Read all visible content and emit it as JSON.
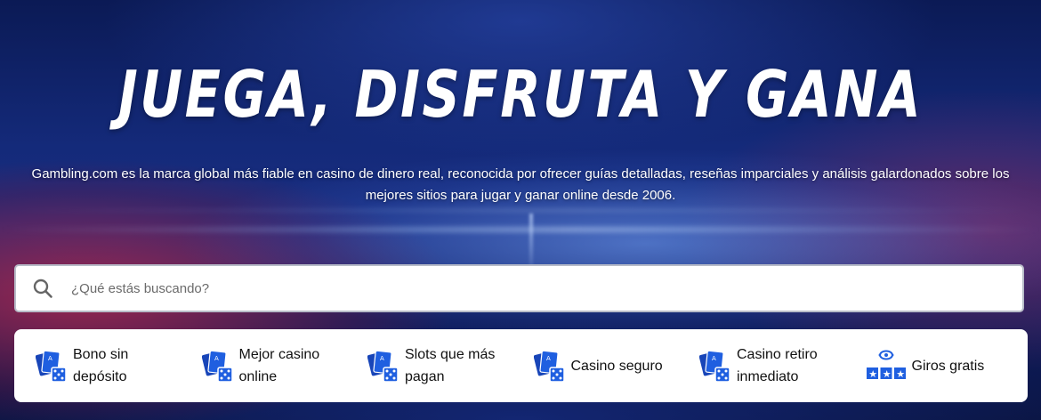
{
  "hero": {
    "title": "JUEGA, DISFRUTA Y GANA",
    "subtitle_line1": "Gambling.com es la marca global más fiable en casino de dinero real, reconocida por ofrecer guías detalladas, reseñas imparciales y análisis galardonados sobre los",
    "subtitle_line2": "mejores sitios para jugar y ganar online desde 2006."
  },
  "search": {
    "placeholder": "¿Qué estás buscando?",
    "value": "",
    "icon": "search-icon"
  },
  "categories": [
    {
      "line1": "Bono sin",
      "line2": "depósito",
      "icon": "cards-dice-icon"
    },
    {
      "line1": "Mejor casino",
      "line2": "online",
      "icon": "cards-dice-icon"
    },
    {
      "line1": "Slots que más",
      "line2": "pagan",
      "icon": "cards-dice-icon"
    },
    {
      "line1": "Casino seguro",
      "line2": "",
      "icon": "cards-dice-icon"
    },
    {
      "line1": "Casino retiro",
      "line2": "inmediato",
      "icon": "cards-dice-icon"
    },
    {
      "line1": "Giros gratis",
      "line2": "",
      "icon": "free-spins-stars-icon"
    }
  ],
  "colors": {
    "accent": "#1f5fe0",
    "icon_dark": "#1845b8",
    "text": "#111111",
    "hero_bg": "#142a7a"
  }
}
